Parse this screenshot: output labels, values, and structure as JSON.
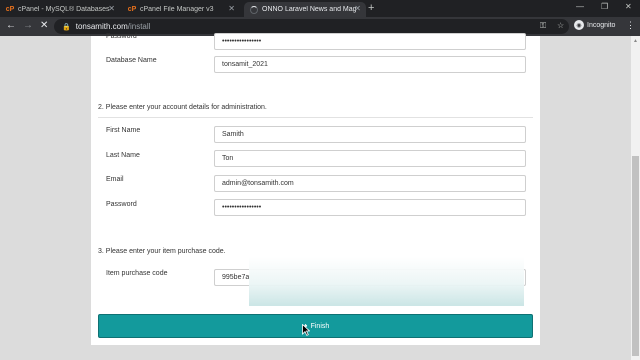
{
  "browser": {
    "tabs": [
      {
        "label": "cPanel - MySQL® Databases",
        "icon": "cpanel-icon",
        "active": false
      },
      {
        "label": "cPanel File Manager v3",
        "icon": "cpanel-icon",
        "active": false
      },
      {
        "label": "ONNO Laravel News and Magazi",
        "icon": "loading-spinner",
        "active": true
      }
    ],
    "url_host": "tonsamith.com",
    "url_path": "/install",
    "profile_label": "Incognito"
  },
  "form": {
    "password_top_label": "Password",
    "password_top_value": "••••••••••••••••",
    "db_name_label": "Database Name",
    "db_name_value": "tonsamit_2021",
    "section2_title": "2. Please enter your account details for administration.",
    "first_name_label": "First Name",
    "first_name_value": "Samith",
    "last_name_label": "Last Name",
    "last_name_value": "Ton",
    "email_label": "Email",
    "email_value": "admin@tonsamith.com",
    "password_label": "Password",
    "password_value": "••••••••••••••••",
    "section3_title": "3. Please enter your item purchase code.",
    "purchase_code_label": "Item purchase code",
    "purchase_code_value": "995be7a",
    "finish_label": "Finish",
    "finish_color": "#139a9c"
  }
}
